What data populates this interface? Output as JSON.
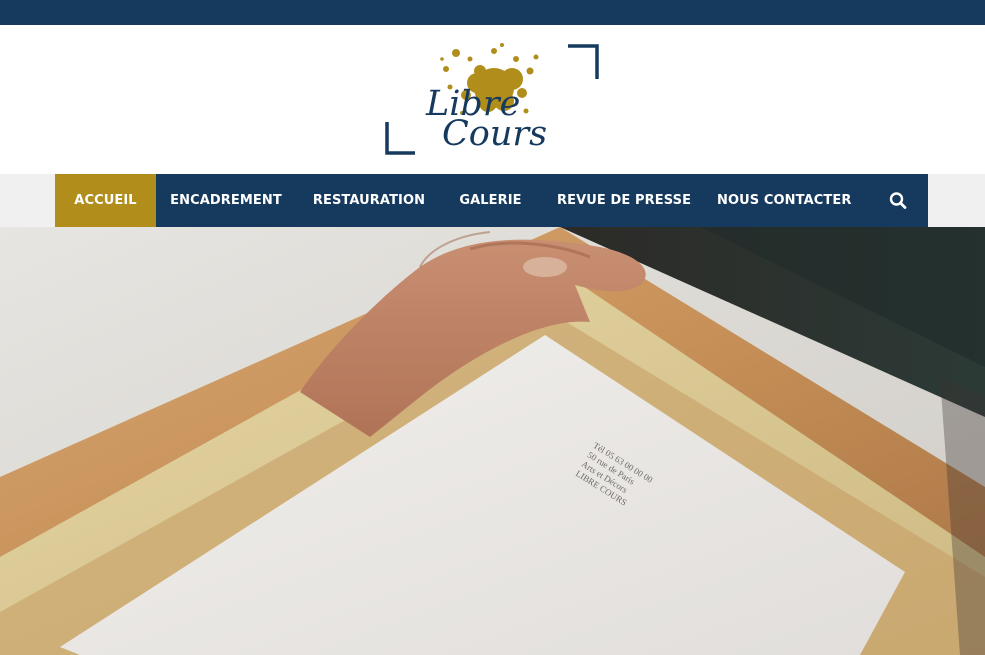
{
  "brand": {
    "logo_line1": "Libre",
    "logo_line2": "Cours",
    "colors": {
      "navy": "#163a5e",
      "gold": "#b18e1b"
    }
  },
  "nav": {
    "items": [
      {
        "label": "ACCUEIL",
        "active": true
      },
      {
        "label": "ENCADREMENT",
        "active": false
      },
      {
        "label": "RESTAURATION",
        "active": false
      },
      {
        "label": "GALERIE",
        "active": false
      },
      {
        "label": "REVUE DE PRESSE",
        "active": false
      },
      {
        "label": "NOUS CONTACTER",
        "active": false
      }
    ],
    "search_icon": "search-icon"
  },
  "hero": {
    "stamp_lines": [
      "LIBRE COURS",
      "Arts et Décors",
      "50 rue de Paris",
      "Tél 05 63 00 00 00"
    ]
  }
}
